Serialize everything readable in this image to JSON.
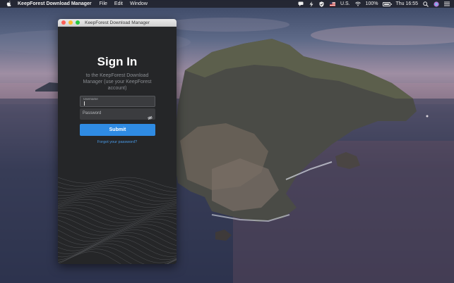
{
  "menubar": {
    "app_name": "KeepForest Download Manager",
    "menus": [
      "File",
      "Edit",
      "Window"
    ],
    "input_source": "U.S.",
    "battery_text": "100%",
    "battery_level": 1.0,
    "clock": "Thu 16:55"
  },
  "window": {
    "title": "KeepForest Download Manager",
    "heading": "Sign In",
    "subheading": "to the KeepForest Download Manager (use your KeepForest account)",
    "username_label": "Username",
    "username_value": "",
    "password_placeholder": "Password",
    "submit_label": "Submit",
    "forgot_link": "Forgot your password?"
  },
  "colors": {
    "window_bg": "#252628",
    "field_bg": "#3b3c3f",
    "accent": "#2f8be3",
    "link": "#4a9be8"
  },
  "icons": {
    "menubar": [
      "apple-icon",
      "message-icon",
      "bolt-icon",
      "shield-icon",
      "flag-icon",
      "wifi-icon",
      "battery-icon",
      "search-icon",
      "siri-icon",
      "control-center-icon"
    ],
    "password_toggle": "eye-slash-icon"
  }
}
